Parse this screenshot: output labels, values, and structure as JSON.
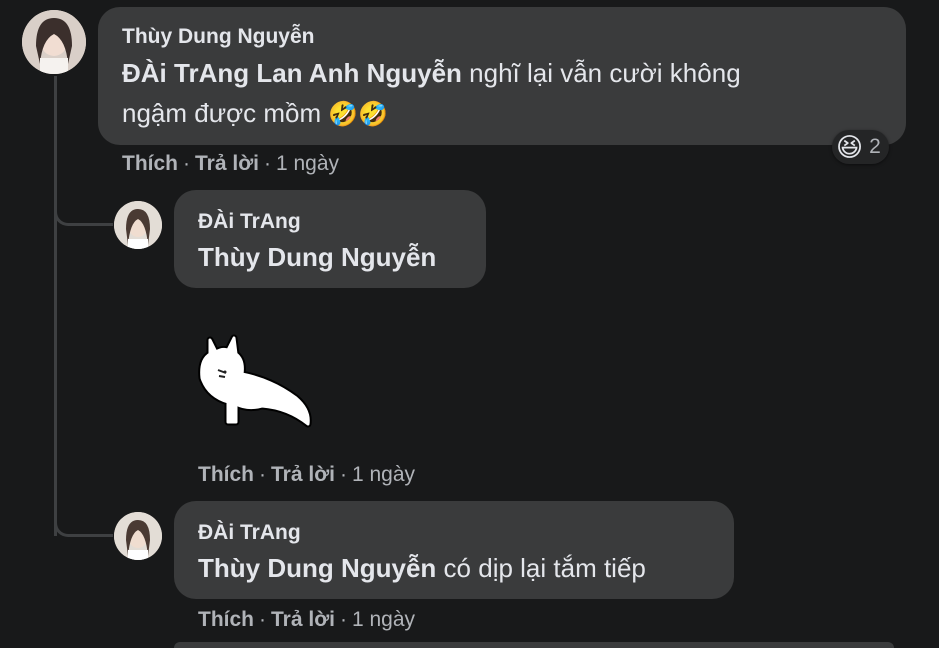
{
  "comments": [
    {
      "author": "Thùy Dung Nguyễn",
      "mention": "ĐÀi TrAng Lan Anh Nguyễn",
      "text_line1": " nghĩ lại vẫn cười không",
      "text_line2": "ngậm được mồm ",
      "emoji": "🤣🤣",
      "reaction_emoji": "😆",
      "reaction_count": "2",
      "like": "Thích",
      "reply": "Trả lời",
      "sep": "·",
      "time": "1 ngày"
    },
    {
      "author": "ĐÀi TrAng",
      "mention": "Thùy Dung Nguyễn",
      "sticker": "bunny-sticker",
      "like": "Thích",
      "reply": "Trả lời",
      "sep": "·",
      "time": "1 ngày"
    },
    {
      "author": "ĐÀi TrAng",
      "mention": "Thùy Dung Nguyễn",
      "text": " có dịp lại tắm tiếp",
      "like": "Thích",
      "reply": "Trả lời",
      "sep": "·",
      "time": "1 ngày"
    }
  ]
}
